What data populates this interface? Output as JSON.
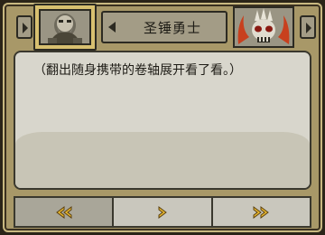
{
  "header": {
    "character_name": "圣锤勇士",
    "left_portrait_icon": "dwarf-warrior-portrait-icon",
    "right_portrait_icon": "demon-skull-portrait-icon",
    "prev_arrow_icon": "triangle-left-icon",
    "next_arrow_icon": "triangle-right-icon"
  },
  "dialog": {
    "text": "（翻出随身携带的卷轴展开看了看。）"
  },
  "controls": {
    "rewind_icon": "double-chevron-left-icon",
    "play_icon": "chevron-right-icon",
    "fast_forward_icon": "double-chevron-right-icon"
  },
  "colors": {
    "gold_accent": "#d8c070",
    "arrow_gold": "#e8b830",
    "panel_bg": "#d8d6cc",
    "frame_bg": "#a89868"
  }
}
